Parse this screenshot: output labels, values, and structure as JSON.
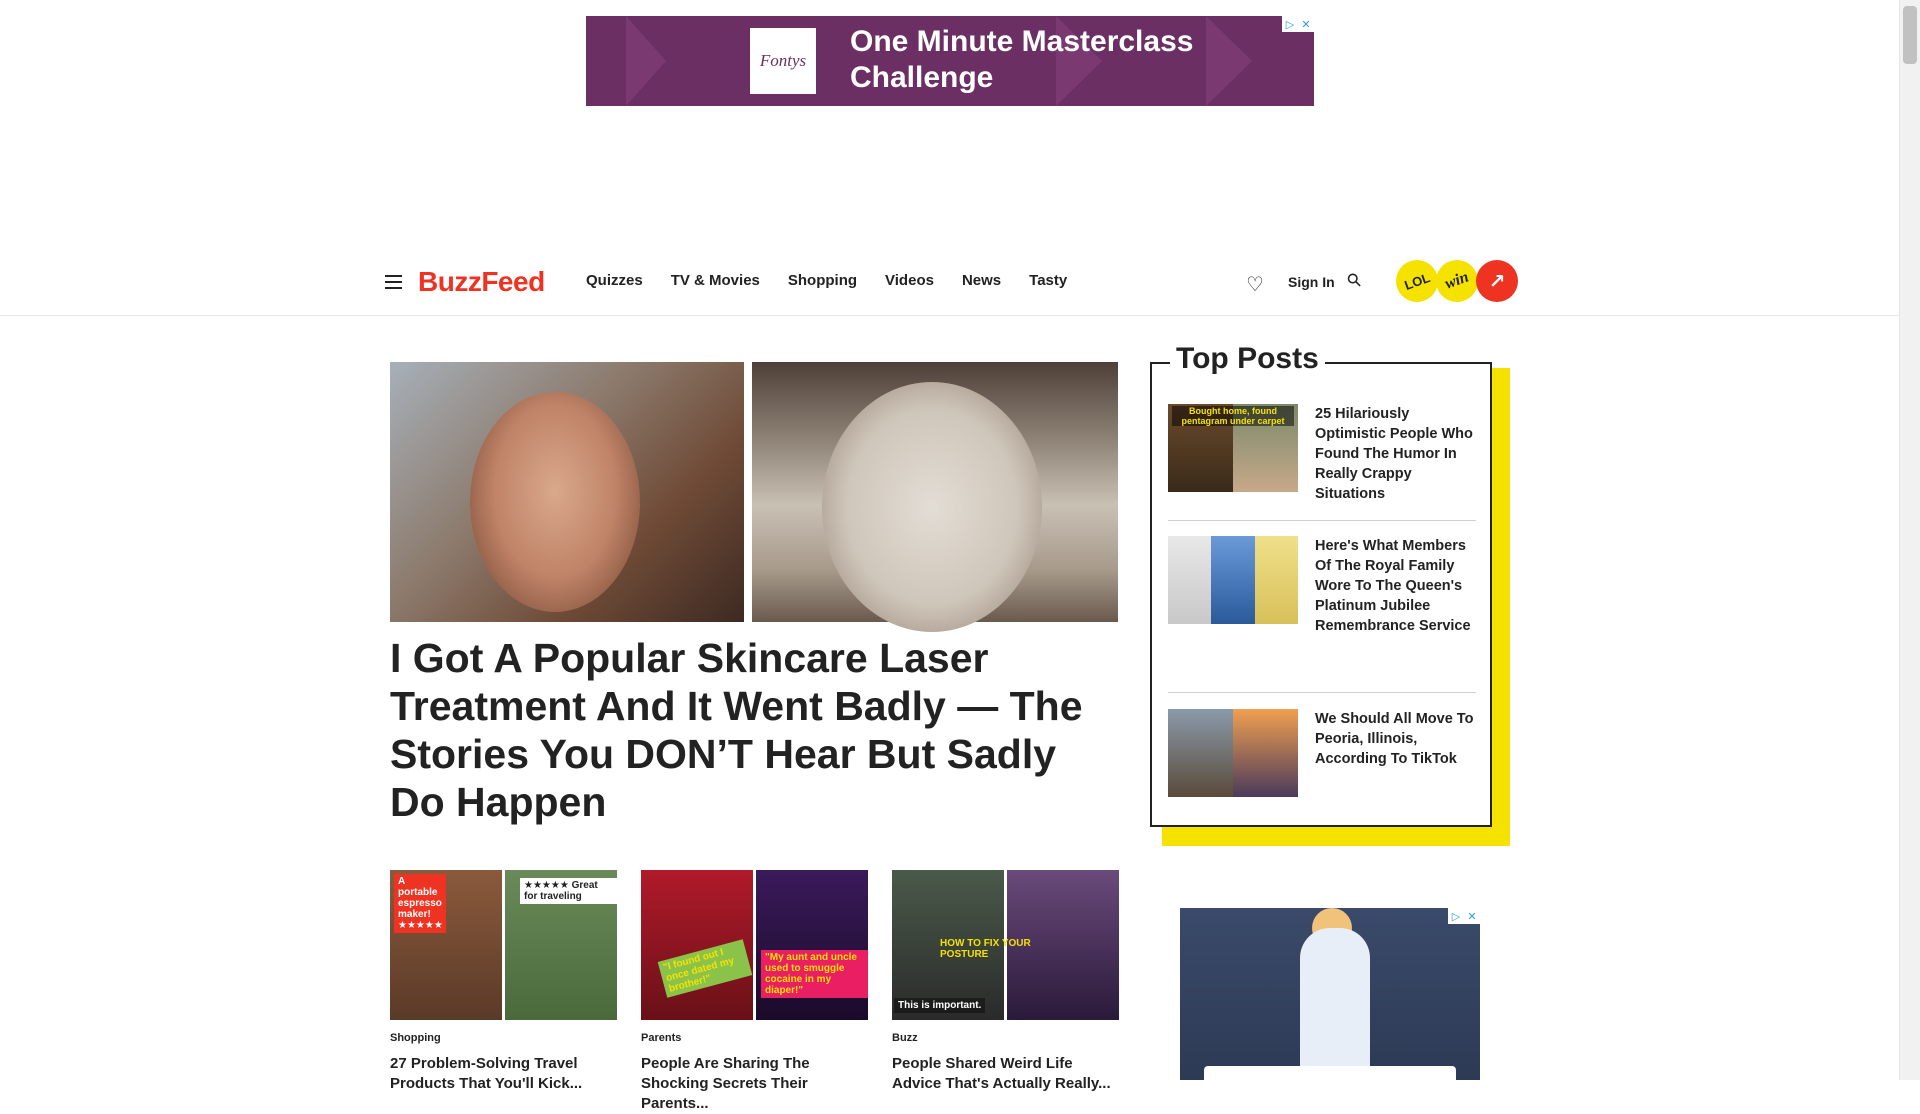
{
  "ad": {
    "brand": "Fontys",
    "headline": "One Minute Masterclass Challenge",
    "adchoices": "▷✕"
  },
  "header": {
    "logo": "BuzzFeed",
    "nav": [
      "Quizzes",
      "TV & Movies",
      "Shopping",
      "Videos",
      "News",
      "Tasty"
    ],
    "signin": "Sign In",
    "badges": {
      "lol": "LOL",
      "win": "win",
      "trending": "↗"
    }
  },
  "hero": {
    "title": "I Got A Popular Skincare Laser Treatment And It Went Badly — The Stories You DON’T Hear But Sadly Do Happen"
  },
  "cards": [
    {
      "category": "Shopping",
      "title": "27 Problem-Solving Travel Products That You'll Kick...",
      "tags": [
        "A portable espresso maker! ★★★★★",
        "★★★★★ Great for traveling"
      ]
    },
    {
      "category": "Parents",
      "title": "People Are Sharing The Shocking Secrets Their Parents...",
      "tags": [
        "\"I found out I once dated my brother!\"",
        "\"My aunt and uncle used to smuggle cocaine in my diaper!\""
      ]
    },
    {
      "category": "Buzz",
      "title": "People Shared Weird Life Advice That's Actually Really...",
      "tags": [
        "HOW TO FIX YOUR POSTURE",
        "This is important."
      ]
    }
  ],
  "top_posts": {
    "heading": "Top Posts",
    "items": [
      {
        "title": "25 Hilariously Optimistic People Who Found The Humor In Really Crappy Situations",
        "thumb_tag": "Bought home, found pentagram under carpet"
      },
      {
        "title": "Here's What Members Of The Royal Family Wore To The Queen's Platinum Jubilee Remembrance Service"
      },
      {
        "title": "We Should All Move To Peoria, Illinois, According To TikTok"
      }
    ]
  },
  "side_ad": {
    "adchoices": "▷✕"
  }
}
